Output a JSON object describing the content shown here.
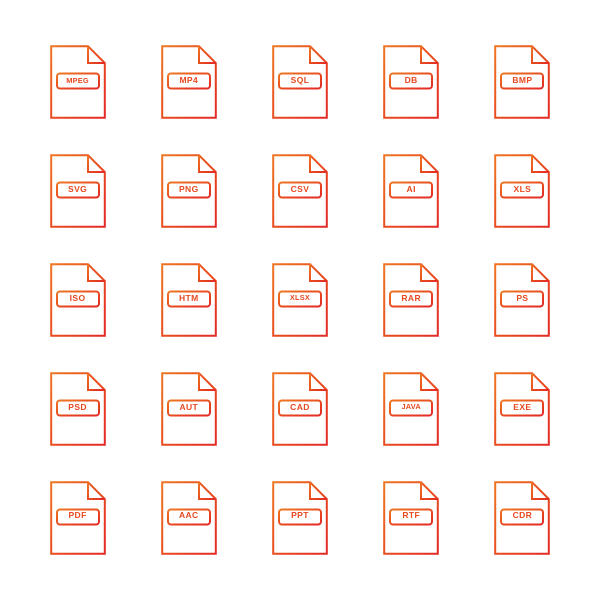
{
  "page": {
    "title": "File Format Icon Set",
    "background_color": "#ffffff",
    "columns": 5,
    "rows": 5
  },
  "style": {
    "gradient_start_color": "#ee7623",
    "gradient_end_color": "#e32a26",
    "label_text_color": "#e8491f",
    "label_border_color": "#ee7623",
    "stroke_width": 2
  },
  "icons": [
    {
      "label": "MPEG",
      "name": "file-icon-mpeg",
      "row": 1,
      "col": 1
    },
    {
      "label": "MP4",
      "name": "file-icon-mp4",
      "row": 1,
      "col": 2
    },
    {
      "label": "SQL",
      "name": "file-icon-sql",
      "row": 1,
      "col": 3
    },
    {
      "label": "DB",
      "name": "file-icon-db",
      "row": 1,
      "col": 4
    },
    {
      "label": "BMP",
      "name": "file-icon-bmp",
      "row": 1,
      "col": 5
    },
    {
      "label": "SVG",
      "name": "file-icon-svg",
      "row": 2,
      "col": 1
    },
    {
      "label": "PNG",
      "name": "file-icon-png",
      "row": 2,
      "col": 2
    },
    {
      "label": "CSV",
      "name": "file-icon-csv",
      "row": 2,
      "col": 3
    },
    {
      "label": "AI",
      "name": "file-icon-ai",
      "row": 2,
      "col": 4
    },
    {
      "label": "XLS",
      "name": "file-icon-xls",
      "row": 2,
      "col": 5
    },
    {
      "label": "ISO",
      "name": "file-icon-iso",
      "row": 3,
      "col": 1
    },
    {
      "label": "HTM",
      "name": "file-icon-htm",
      "row": 3,
      "col": 2
    },
    {
      "label": "XLSX",
      "name": "file-icon-xlsx",
      "row": 3,
      "col": 3
    },
    {
      "label": "RAR",
      "name": "file-icon-rar",
      "row": 3,
      "col": 4
    },
    {
      "label": "PS",
      "name": "file-icon-ps",
      "row": 3,
      "col": 5
    },
    {
      "label": "PSD",
      "name": "file-icon-psd",
      "row": 4,
      "col": 1
    },
    {
      "label": "AUT",
      "name": "file-icon-aut",
      "row": 4,
      "col": 2
    },
    {
      "label": "CAD",
      "name": "file-icon-cad",
      "row": 4,
      "col": 3
    },
    {
      "label": "JAVA",
      "name": "file-icon-java",
      "row": 4,
      "col": 4
    },
    {
      "label": "EXE",
      "name": "file-icon-exe",
      "row": 4,
      "col": 5
    },
    {
      "label": "PDF",
      "name": "file-icon-pdf",
      "row": 5,
      "col": 1
    },
    {
      "label": "AAC",
      "name": "file-icon-aac",
      "row": 5,
      "col": 2
    },
    {
      "label": "PPT",
      "name": "file-icon-ppt",
      "row": 5,
      "col": 3
    },
    {
      "label": "RTF",
      "name": "file-icon-rtf",
      "row": 5,
      "col": 4
    },
    {
      "label": "CDR",
      "name": "file-icon-cdr",
      "row": 5,
      "col": 5
    }
  ]
}
